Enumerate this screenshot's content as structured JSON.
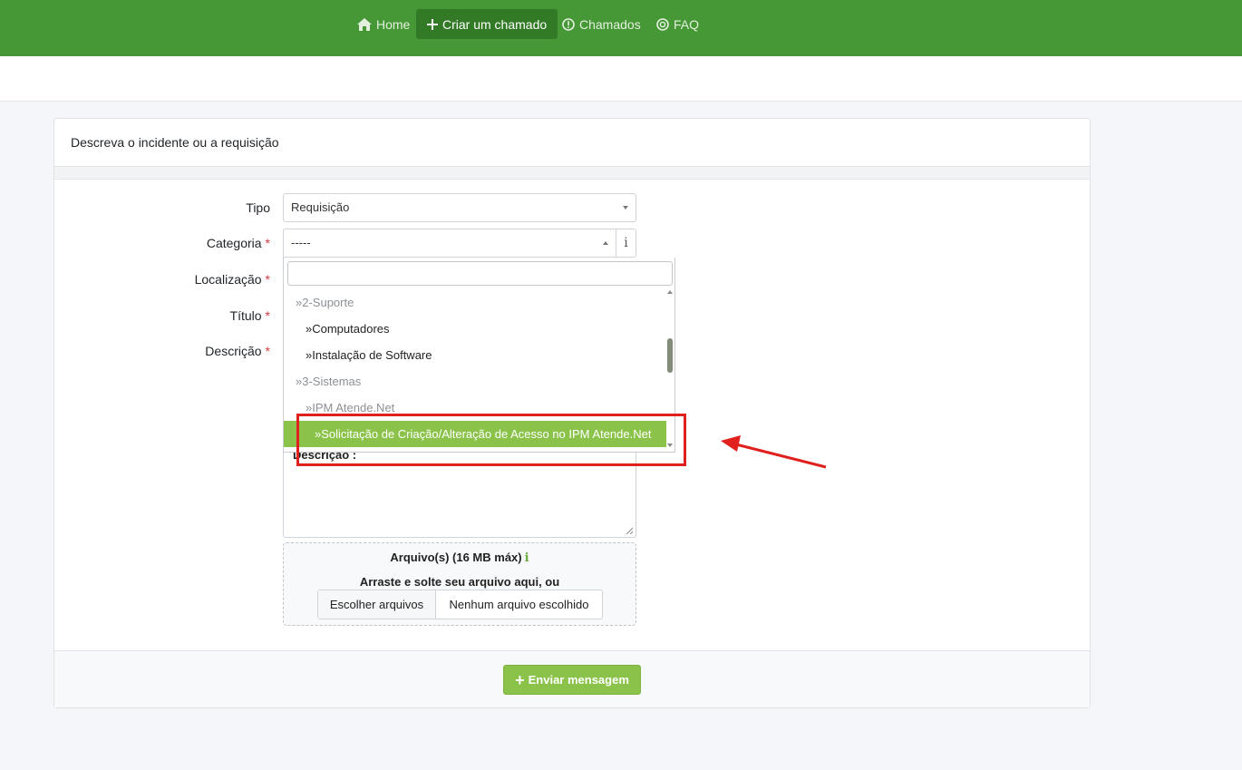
{
  "nav": {
    "home": "Home",
    "create": "Criar um chamado",
    "tickets": "Chamados",
    "faq": "FAQ"
  },
  "card": {
    "header": "Descreva o incidente ou a requisição"
  },
  "form": {
    "tipo_label": "Tipo",
    "tipo_value": "Requisição",
    "categoria_label": "Categoria",
    "categoria_value": "-----",
    "info_glyph": "i",
    "localizacao_label": "Localização",
    "titulo_label": "Título",
    "descricao_label": "Descrição",
    "required_mark": "*",
    "descricao_text": "Descrição :"
  },
  "dropdown": {
    "search_value": "",
    "items": [
      {
        "label": "»2-Suporte",
        "kind": "group"
      },
      {
        "label": "»Computadores",
        "kind": "child"
      },
      {
        "label": "»Instalação de Software",
        "kind": "child"
      },
      {
        "label": "»3-Sistemas",
        "kind": "group"
      },
      {
        "label": "»IPM Atende.Net",
        "kind": "child-muted"
      },
      {
        "label": "»Solicitação de Criação/Alteração de Acesso no IPM Atende.Net",
        "kind": "highlight"
      }
    ]
  },
  "upload": {
    "title": "Arquivo(s) (16 MB máx)",
    "info_glyph": "i",
    "drag_text": "Arraste e solte seu arquivo aqui, ou",
    "choose_button": "Escolher arquivos",
    "status": "Nenhum arquivo escolhido"
  },
  "submit": {
    "label": "Enviar mensagem"
  },
  "colors": {
    "navbar": "#469836",
    "accent": "#8bc34a",
    "annotation": "#e0201c"
  }
}
